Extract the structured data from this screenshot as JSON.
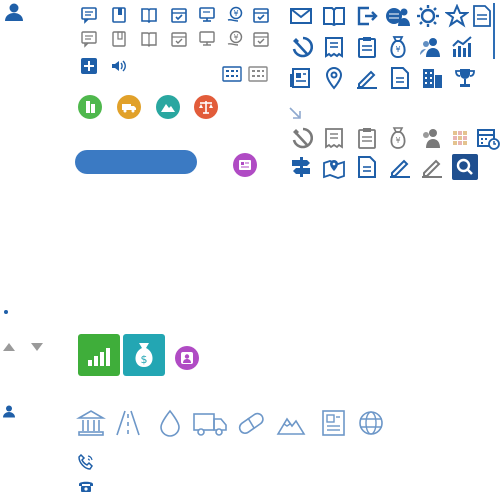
{
  "colors": {
    "primary_blue": "#1f5fa8",
    "light_blue": "#3b7ac3",
    "gray_icon": "#7a7a7a",
    "green_circle": "#4fb84d",
    "orange_circle": "#e1a12a",
    "teal_circle": "#2aa7a0",
    "red_circle": "#e25c3a",
    "purple_badge": "#b04bc4",
    "green_tile": "#3fae3a",
    "teal_tile": "#23a6b3",
    "outline_blue": "#6d97c8"
  },
  "icons": {
    "user_profile": "user-icon",
    "row1": [
      "message-icon",
      "book-open-icon",
      "book-icon",
      "calendar-check-icon",
      "monitor-icon",
      "yen-hand-icon",
      "calendar-check-icon"
    ],
    "row2": [
      "message-icon",
      "book-open-icon",
      "book-icon",
      "calendar-check-icon",
      "monitor-icon",
      "yen-hand-icon",
      "calendar-check-icon"
    ],
    "blue_row1": [
      "envelope-icon",
      "book-icon",
      "export-icon",
      "globe-users-icon",
      "badge-icon",
      "star-icon",
      "document-icon"
    ],
    "blue_row2": [
      "hammer-sickle-icon",
      "receipt-icon",
      "clipboard-icon",
      "money-bag-icon",
      "group-icon",
      "chart-up-icon"
    ],
    "blue_row3": [
      "newspaper-icon",
      "map-pin-icon",
      "pen-icon",
      "document-icon",
      "building-icon",
      "trophy-icon"
    ],
    "gray_row": [
      "hammer-sickle-icon",
      "receipt-icon",
      "clipboard-icon",
      "money-bag-icon",
      "group-icon",
      "grid-icon",
      "calendar-clock-icon"
    ],
    "blue_row4": [
      "signpost-icon",
      "map-icon",
      "document-icon",
      "pen-icon",
      "pen-icon",
      "search-icon"
    ],
    "category_circles": [
      "building-icon",
      "truck-icon",
      "mountain-icon",
      "scale-icon"
    ],
    "outline_row": [
      "bank-icon",
      "road-icon",
      "drop-icon",
      "truck-icon",
      "pill-icon",
      "mountain-icon",
      "newspaper-icon",
      "globe-icon"
    ]
  },
  "primary_button": {
    "label": ""
  }
}
